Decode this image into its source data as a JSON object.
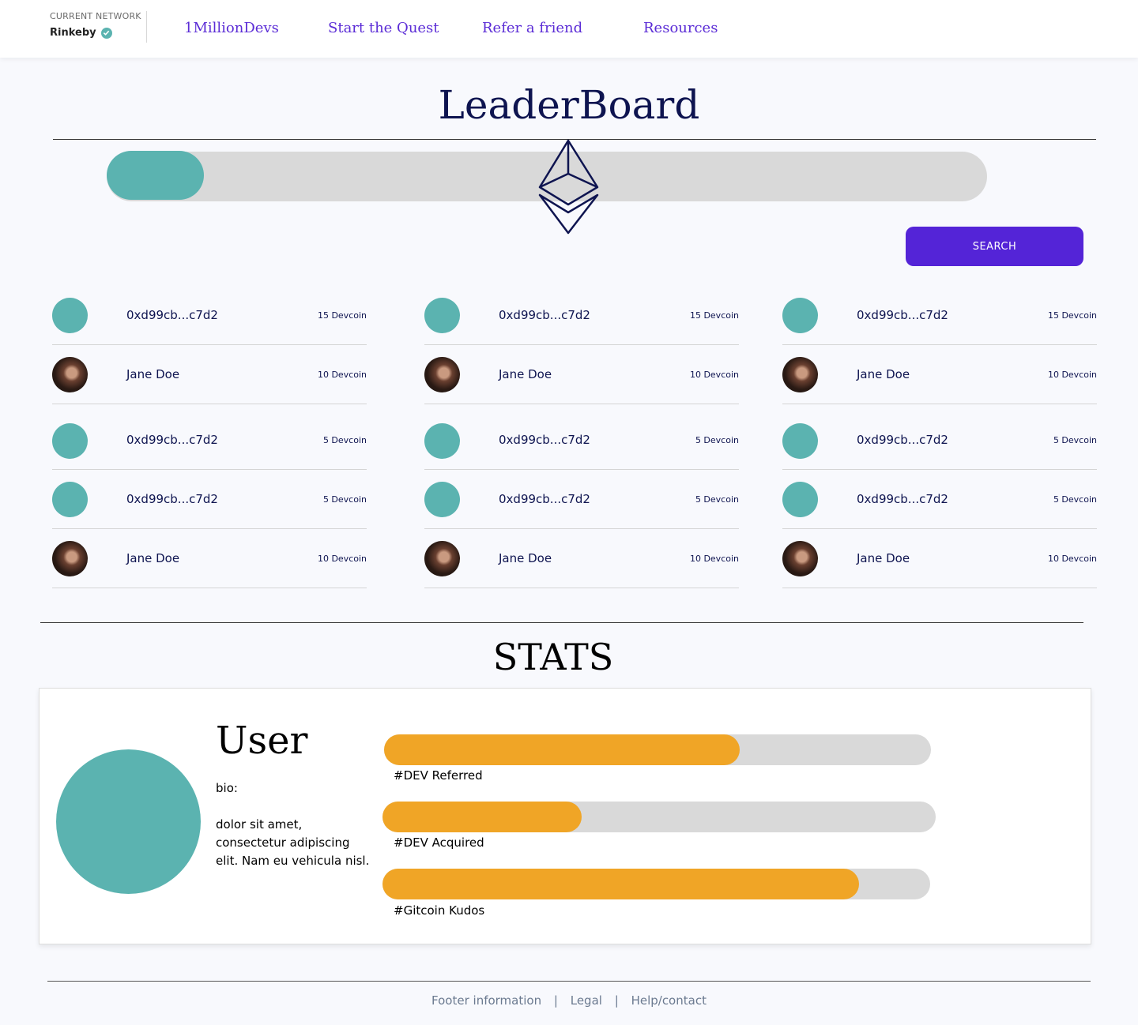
{
  "header": {
    "network_label": "CURRENT NETWORK",
    "network_value": "Rinkeby",
    "nav": [
      "1MillionDevs",
      "Start the Quest",
      "Refer a friend",
      "Resources"
    ]
  },
  "leaderboard": {
    "title": "LeaderBoard",
    "progress_fraction": 0.11,
    "search_label": "SEARCH",
    "columns": [
      {
        "rows": [
          {
            "name": "0xd99cb...c7d2",
            "score": "15 Devcoin"
          },
          {
            "name": "Jane Doe",
            "score": "10 Devcoin"
          },
          {
            "name": "0xd99cb...c7d2",
            "score": "5 Devcoin"
          },
          {
            "name": "0xd99cb...c7d2",
            "score": "5 Devcoin"
          },
          {
            "name": "Jane Doe",
            "score": "10 Devcoin"
          }
        ]
      },
      {
        "rows": [
          {
            "name": "0xd99cb...c7d2",
            "score": "15 Devcoin"
          },
          {
            "name": "Jane Doe",
            "score": "10 Devcoin"
          },
          {
            "name": "0xd99cb...c7d2",
            "score": "5 Devcoin"
          },
          {
            "name": "0xd99cb...c7d2",
            "score": "5 Devcoin"
          },
          {
            "name": "Jane Doe",
            "score": "10 Devcoin"
          }
        ]
      },
      {
        "rows": [
          {
            "name": "0xd99cb...c7d2",
            "score": "15 Devcoin"
          },
          {
            "name": "Jane Doe",
            "score": "10 Devcoin"
          },
          {
            "name": "0xd99cb...c7d2",
            "score": "5 Devcoin"
          },
          {
            "name": "0xd99cb...c7d2",
            "score": "5 Devcoin"
          },
          {
            "name": "Jane Doe",
            "score": "10 Devcoin"
          }
        ]
      }
    ]
  },
  "stats": {
    "title": "STATS",
    "user_name": "User",
    "bio_label": "bio:",
    "bio_text": "dolor sit amet, consectetur adipiscing elit. Nam eu vehicula nisl.",
    "bars": [
      {
        "label": "#DEV Referred",
        "fraction": 0.65
      },
      {
        "label": "#DEV Acquired",
        "fraction": 0.36
      },
      {
        "label": "#Gitcoin Kudos",
        "fraction": 0.87
      }
    ]
  },
  "footer": {
    "links": [
      "Footer information",
      "Legal",
      "Help/contact"
    ],
    "separator": "|"
  },
  "colors": {
    "accent": "#5424d7",
    "teal": "#5bb3b0",
    "orange": "#f0a526",
    "navy": "#0e1450"
  },
  "icons": [
    "check-circle-icon",
    "ethereum-icon"
  ]
}
